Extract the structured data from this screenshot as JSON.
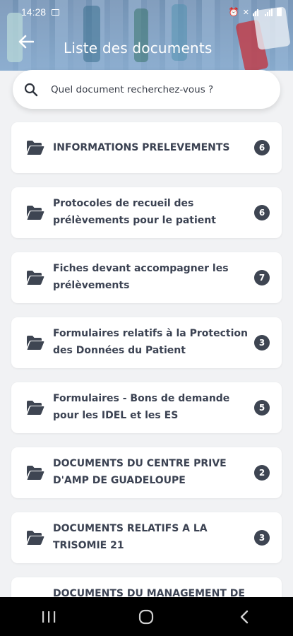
{
  "status_bar": {
    "time": "14:28"
  },
  "header": {
    "title": "Liste des documents"
  },
  "search": {
    "placeholder": "Quel document recherchez-vous ?"
  },
  "documents": [
    {
      "label": "INFORMATIONS PRELEVEMENTS",
      "count": "6"
    },
    {
      "label": "Protocoles de recueil des prélèvements pour le patient",
      "count": "6"
    },
    {
      "label": "Fiches devant accompagner les prélèvements",
      "count": "7"
    },
    {
      "label": "Formulaires relatifs à la Protection des Données du Patient",
      "count": "3"
    },
    {
      "label": "Formulaires - Bons de demande pour les IDEL et les ES",
      "count": "5"
    },
    {
      "label": "DOCUMENTS DU CENTRE PRIVE D'AMP DE GUADELOUPE",
      "count": "2"
    },
    {
      "label": "DOCUMENTS RELATIFS A LA TRISOMIE 21",
      "count": "3"
    },
    {
      "label": "DOCUMENTS DU MANAGEMENT DE",
      "count": ""
    }
  ],
  "colors": {
    "badge": "#3e4552",
    "text": "#3b4252",
    "background": "#f1f2f4"
  },
  "icons": {
    "back": "arrow-left-icon",
    "search": "search-icon",
    "folder": "folder-open-icon"
  }
}
